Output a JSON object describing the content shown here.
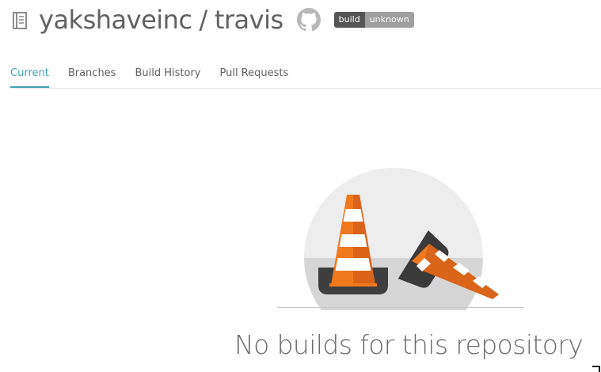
{
  "repo": {
    "owner": "yakshaveinc",
    "separator": "/",
    "name": "travis",
    "icon": "repo-book-icon",
    "github_icon": "github-octocat-icon"
  },
  "badge": {
    "left_label": "build",
    "right_label": "unknown",
    "left_color": "#555555",
    "right_color": "#9f9f9f"
  },
  "tabs": [
    {
      "label": "Current",
      "active": true
    },
    {
      "label": "Branches",
      "active": false
    },
    {
      "label": "Build History",
      "active": false
    },
    {
      "label": "Pull Requests",
      "active": false
    }
  ],
  "empty_state": {
    "message": "No builds for this repository",
    "illustration": "traffic-cones-icon"
  },
  "colors": {
    "accent": "#3fa1b3",
    "text": "#616161",
    "cone_orange": "#f0791e",
    "cone_base": "#404040"
  }
}
